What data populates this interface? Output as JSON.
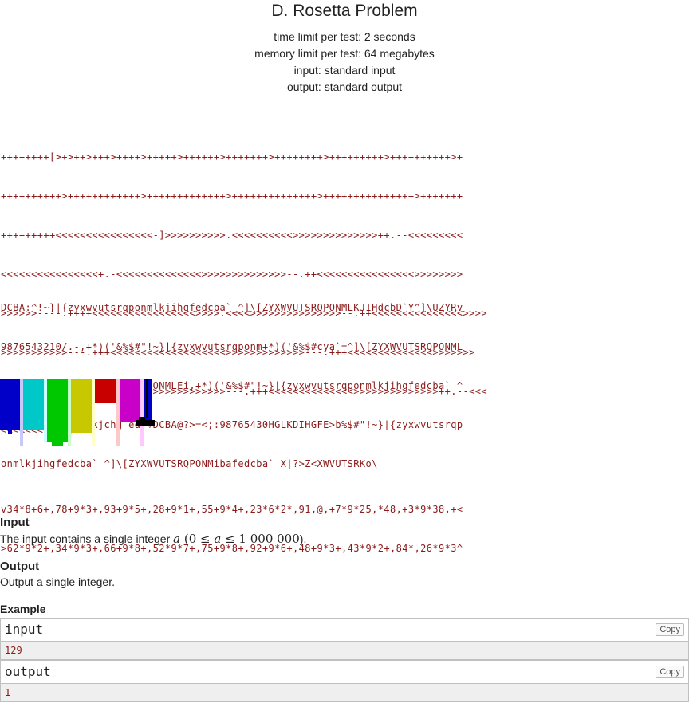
{
  "problem": {
    "title": "D. Rosetta Problem",
    "time_limit": "time limit per test: 2 seconds",
    "memory_limit": "memory limit per test: 64 megabytes",
    "input_spec": "input: standard input",
    "output_spec": "output: standard output"
  },
  "brainfuck_lines": [
    "++++++++[>+>++>+++>++++>+++++>++++++>+++++++>++++++++>+++++++++>++++++++++>+",
    "++++++++++>++++++++++++>+++++++++++++>++++++++++++++>+++++++++++++++>+++++++",
    "+++++++++<<<<<<<<<<<<<<<<-]>>>>>>>>>>.<<<<<<<<<<>>>>>>>>>>>>>>++.--<<<<<<<<<",
    "<<<<<<<<<<<<<<<<+.-<<<<<<<<<<<<<<>>>>>>>>>>>>>>--.++<<<<<<<<<<<<<<<<>>>>>>>>",
    ">>>>>>----.++++<<<<<<<<<<<<<<<<<>>>>.<<<<>>>>>>>>>>>>>>>--.++<<<<<<<<<<<<<<<>>>>",
    ">>>>>>>>>>>---.+++<<<<<<<<<<<<<<<<<<<>>>>>>>>>>>>>---.+++<<<<<<<<<<<<<<>>>>>>>",
    ">>>>++.--<<<<<<<<<<<<<<<<>>>>>>>>>>>>---.+++<<<<<<<<<<<<<<>>>>>>>>>>>>>>++.--<<<",
    "<<<<<<<<<<<."
  ],
  "befunge_lines": [
    "DCBA:^!~}|{zyxwvutsrqponmlkjihgfedcba`_^]\\[ZYXWVUTSRQPONMLKJIHdcbD`Y^]\\UZYRv",
    "9876543210/.-,+*)('&%$#\"!~}|{zyxwvutsrqponm+*)('&%$#cya`=^]\\[ZYXWVUTSRQPONML",
    "KJfe^cba`_X]VzTYRv98TSRQ3ONMLEi,+*)('&%$#\"!~}|{zyxwvutsrqponmlkjihgfedcba`_^",
    "]\\[ZYXWVUTSonPlkjchg`ed]#DCBA@?>=<;:987654З0HGLKDIHGFE>b%$#\"!~}|{zyxwvutsrqp",
    "onmlkjihgfedcba`_^]\\[ZYXWVUTSRQPONMibafedcba`_X|?>Z<XWVUTSRKo\\"
  ],
  "arith_lines": [
    "v34*8+6+,78+9*3+,93+9*5+,28+9*1+,55+9*4+,23*6*2*,91,@,+7*9*25,*48,+3*9*38,+<",
    ">62*9*2+,34*9*3+,66+9*8+,52*9*7+,75+9*8+,92+9*6+,48+9*3+,43*9*2+,84*,26*9*3^"
  ],
  "input_section": {
    "title": "Input",
    "text_before": "The input contains a single integer ",
    "var": "a",
    "bound_low": "(0 ≤ ",
    "bound_high": " ≤ 1 000 000",
    "text_after": ")."
  },
  "output_section": {
    "title": "Output",
    "text": "Output a single integer."
  },
  "example": {
    "title": "Example",
    "input_label": "input",
    "input_value": "129",
    "output_label": "output",
    "output_value": "1",
    "copy_label": "Copy"
  },
  "colors": {
    "code": "#8b1a1a",
    "bar_blue": "#0000c8",
    "bar_cyan": "#00c8c8",
    "bar_green": "#00c800",
    "bar_olive": "#c8c800",
    "bar_red": "#c80000",
    "bar_magenta": "#c800c8",
    "bar_black": "#000000"
  }
}
